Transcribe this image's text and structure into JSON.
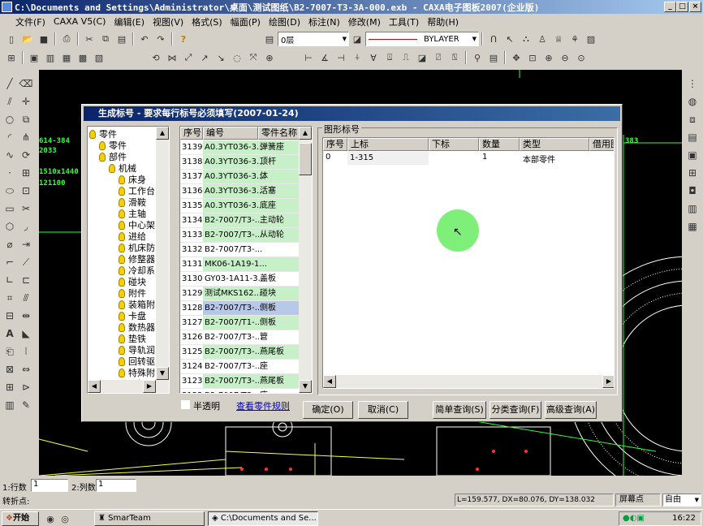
{
  "window": {
    "title": "C:\\Documents and Settings\\Administrator\\桌面\\测试图纸\\B2-7007-T3-3A-000.exb - CAXA电子图板2007(企业版)"
  },
  "menu": [
    "文件(F)",
    "CAXA V5(C)",
    "编辑(E)",
    "视图(V)",
    "格式(S)",
    "幅面(P)",
    "绘图(D)",
    "标注(N)",
    "修改(M)",
    "工具(T)",
    "帮助(H)"
  ],
  "toolbar": {
    "layer": "0层",
    "linetype": "BYLAYER"
  },
  "canvas_labels": [
    "614-384",
    "2033",
    "1510x1440",
    "121100",
    "383"
  ],
  "dialog": {
    "title": "生成标号 - 要求每行标号必须填写(2007-01-24)",
    "tree": [
      {
        "label": "零件",
        "level": 0
      },
      {
        "label": "零件",
        "level": 1
      },
      {
        "label": "部件",
        "level": 1
      },
      {
        "label": "机械",
        "level": 2
      },
      {
        "label": "床身",
        "level": 3
      },
      {
        "label": "工作台",
        "level": 3
      },
      {
        "label": "滑鞍",
        "level": 3
      },
      {
        "label": "主轴",
        "level": 3
      },
      {
        "label": "中心架",
        "level": 3
      },
      {
        "label": "进给",
        "level": 3
      },
      {
        "label": "机床防",
        "level": 3
      },
      {
        "label": "修整器",
        "level": 3
      },
      {
        "label": "冷却系",
        "level": 3
      },
      {
        "label": "碰块",
        "level": 3
      },
      {
        "label": "附件",
        "level": 3
      },
      {
        "label": "装箱附",
        "level": 3
      },
      {
        "label": "卡盘",
        "level": 3
      },
      {
        "label": "数热器",
        "level": 3
      },
      {
        "label": "垫铁",
        "level": 3
      },
      {
        "label": "导轨润",
        "level": 3
      },
      {
        "label": "回转驱",
        "level": 3
      },
      {
        "label": "特殊附",
        "level": 3
      },
      {
        "label": "头架",
        "level": 3
      }
    ],
    "part_columns": [
      "序号",
      "编号",
      "零件名称"
    ],
    "parts": [
      {
        "no": "3139",
        "code": "A0.3YT036-3...",
        "name": "弹簧座",
        "hl": true
      },
      {
        "no": "3138",
        "code": "A0.3YT036-3...",
        "name": "顶杆",
        "hl": true
      },
      {
        "no": "3137",
        "code": "A0.3YT036-3...",
        "name": "体",
        "hl": true
      },
      {
        "no": "3136",
        "code": "A0.3YT036-3...",
        "name": "活塞",
        "hl": true
      },
      {
        "no": "3135",
        "code": "A0.3YT036-3...",
        "name": "底座",
        "hl": true
      },
      {
        "no": "3134",
        "code": "B2-7007/T3-...",
        "name": "主动轮",
        "hl": true
      },
      {
        "no": "3133",
        "code": "B2-7007/T3-...",
        "name": "从动轮",
        "hl": true
      },
      {
        "no": "3132",
        "code": "B2-7007/T3-...",
        "name": "",
        "hl": false
      },
      {
        "no": "3131",
        "code": "MK06-1A19-1...",
        "name": "",
        "hl": true
      },
      {
        "no": "3130",
        "code": "GY03-1A11-3...",
        "name": "盖板",
        "hl": false
      },
      {
        "no": "3129",
        "code": "测试MKS162...",
        "name": "碰块",
        "hl": true
      },
      {
        "no": "3128",
        "code": "B2-7007/T3-...",
        "name": "侧板",
        "hl": true,
        "sel": true
      },
      {
        "no": "3127",
        "code": "B2-7007/T1-...",
        "name": "侧板",
        "hl": true
      },
      {
        "no": "3126",
        "code": "B2-7007/T3-...",
        "name": "管",
        "hl": false
      },
      {
        "no": "3125",
        "code": "B2-7007/T3-...",
        "name": "燕尾板",
        "hl": true
      },
      {
        "no": "3124",
        "code": "B2-7007/T3-...",
        "name": "座",
        "hl": false
      },
      {
        "no": "3123",
        "code": "B2-7007/T3-...",
        "name": "燕尾板",
        "hl": true
      },
      {
        "no": "3122",
        "code": "B2-7007/T3-...",
        "name": "座",
        "hl": false
      }
    ],
    "group_label": "图形标号",
    "grid_columns": [
      "序号",
      "上标",
      "下标",
      "数量",
      "类型",
      "借用图"
    ],
    "grid_rows": [
      {
        "seq": "0",
        "upper": "1-315",
        "lower": "",
        "qty": "1",
        "type": "本部零件",
        "borrow": ""
      }
    ],
    "translucent_label": "半透明",
    "rules_link": "查看零件规则",
    "buttons": {
      "ok": "确定(O)",
      "cancel": "取消(C)",
      "simple": "简单查询(S)",
      "category": "分类查询(F)",
      "advanced": "高级查询(A)"
    }
  },
  "cmd": {
    "rows_label": "1:行数",
    "rows_value": "1",
    "cols_label": "2:列数",
    "cols_value": "1"
  },
  "status": {
    "prompt": "转折点:",
    "coords": "L=159.577, DX=80.076, DY=138.032",
    "screen_point": "屏幕点",
    "mode": "自由"
  },
  "taskbar": {
    "start": "开始",
    "task1": "SmarTeam",
    "task2": "C:\\Documents and Se...",
    "clock": "16:22"
  }
}
